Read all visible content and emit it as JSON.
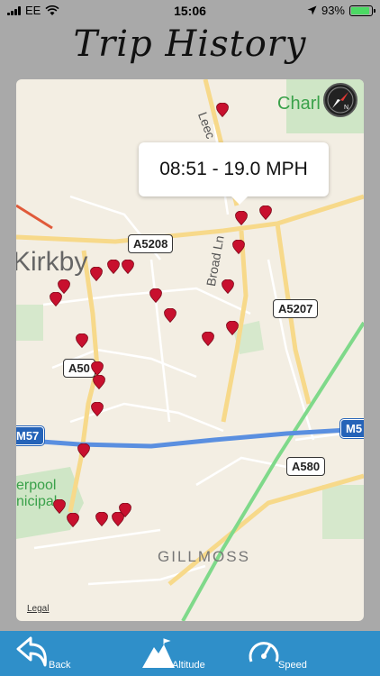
{
  "status": {
    "carrier": "EE",
    "time": "15:06",
    "battery": "93%",
    "battery_level": 0.93
  },
  "title": "Trip History",
  "map": {
    "tooltip": "08:51 - 19.0 MPH",
    "places": [
      "Kirkby",
      "Broad Ln",
      "GILLMOSS",
      "Charl",
      "Leec",
      "erpool",
      "nicipal"
    ],
    "roads": [
      "A5208",
      "A5207",
      "A50",
      "A580",
      "M57",
      "M5"
    ],
    "legal": "Legal"
  },
  "tabs": {
    "back": "Back",
    "altitude": "Altitude",
    "speed": "Speed"
  },
  "colors": {
    "tab_bar": "#2f8fc9",
    "marker": "#c8102e",
    "motorway": "#5a8fe0",
    "green_route": "#7fd98a"
  }
}
